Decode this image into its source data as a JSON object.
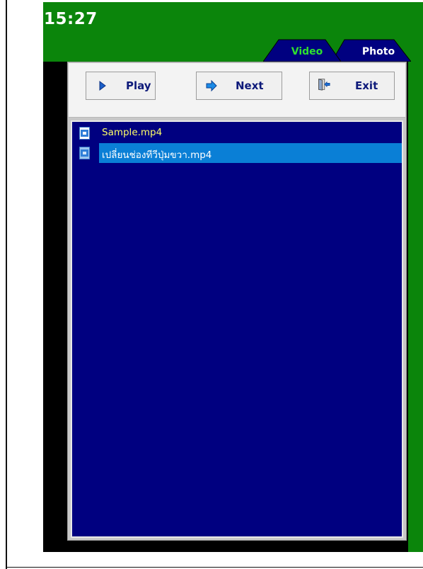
{
  "status": {
    "time": "15:27"
  },
  "tabs": [
    {
      "label": "Video",
      "active": true
    },
    {
      "label": "Photo",
      "active": false
    }
  ],
  "toolbar": {
    "play_label": "Play",
    "next_label": "Next",
    "exit_label": "Exit"
  },
  "file_list": {
    "items": [
      {
        "name": "Sample.mp4",
        "selected": false
      },
      {
        "name": "เปลี่ยนช่องทีวีปุ่มขวา.mp4",
        "selected": true
      }
    ]
  },
  "colors": {
    "header_green": "#0b850b",
    "list_background": "#000080",
    "selection": "#0a7fd6",
    "active_tab_text": "#2ee02e",
    "file_name_text": "#ffff66",
    "button_text": "#0e1a7a"
  },
  "icons": {
    "play": "play-triangle-icon",
    "next": "next-arrow-icon",
    "exit": "exit-door-icon",
    "file": "video-file-icon"
  }
}
